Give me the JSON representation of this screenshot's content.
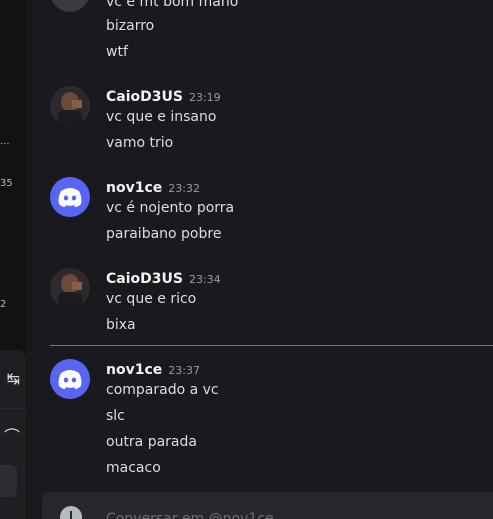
{
  "sidebar": {
    "fragments": [
      "...",
      "35",
      "2"
    ],
    "panel_icons": [
      "↹",
      "⌒"
    ]
  },
  "messages": {
    "top_lines": [
      "vc e mt bom mano",
      "bizarro",
      "wtf"
    ],
    "groups": [
      {
        "username": "CaioD3US",
        "time": "23:19",
        "avatar": "photo",
        "lines": [
          "vc que e insano",
          "vamo trio"
        ]
      },
      {
        "username": "nov1ce",
        "time": "23:32",
        "avatar": "discord",
        "lines": [
          "vc é nojento porra",
          "paraibano pobre"
        ]
      },
      {
        "username": "CaioD3US",
        "time": "23:34",
        "avatar": "photo",
        "lines": [
          "vc que e rico",
          "bixa"
        ]
      },
      {
        "username": "nov1ce",
        "time": "23:37",
        "avatar": "discord",
        "lines": [
          "comparado a vc",
          "slc",
          "outra parada",
          "macaco"
        ]
      }
    ]
  },
  "composer": {
    "placeholder": "Conversar em @nov1ce"
  },
  "colors": {
    "discord_blurple": "#5865f2",
    "new_messages_divider": "#e04a4a"
  }
}
